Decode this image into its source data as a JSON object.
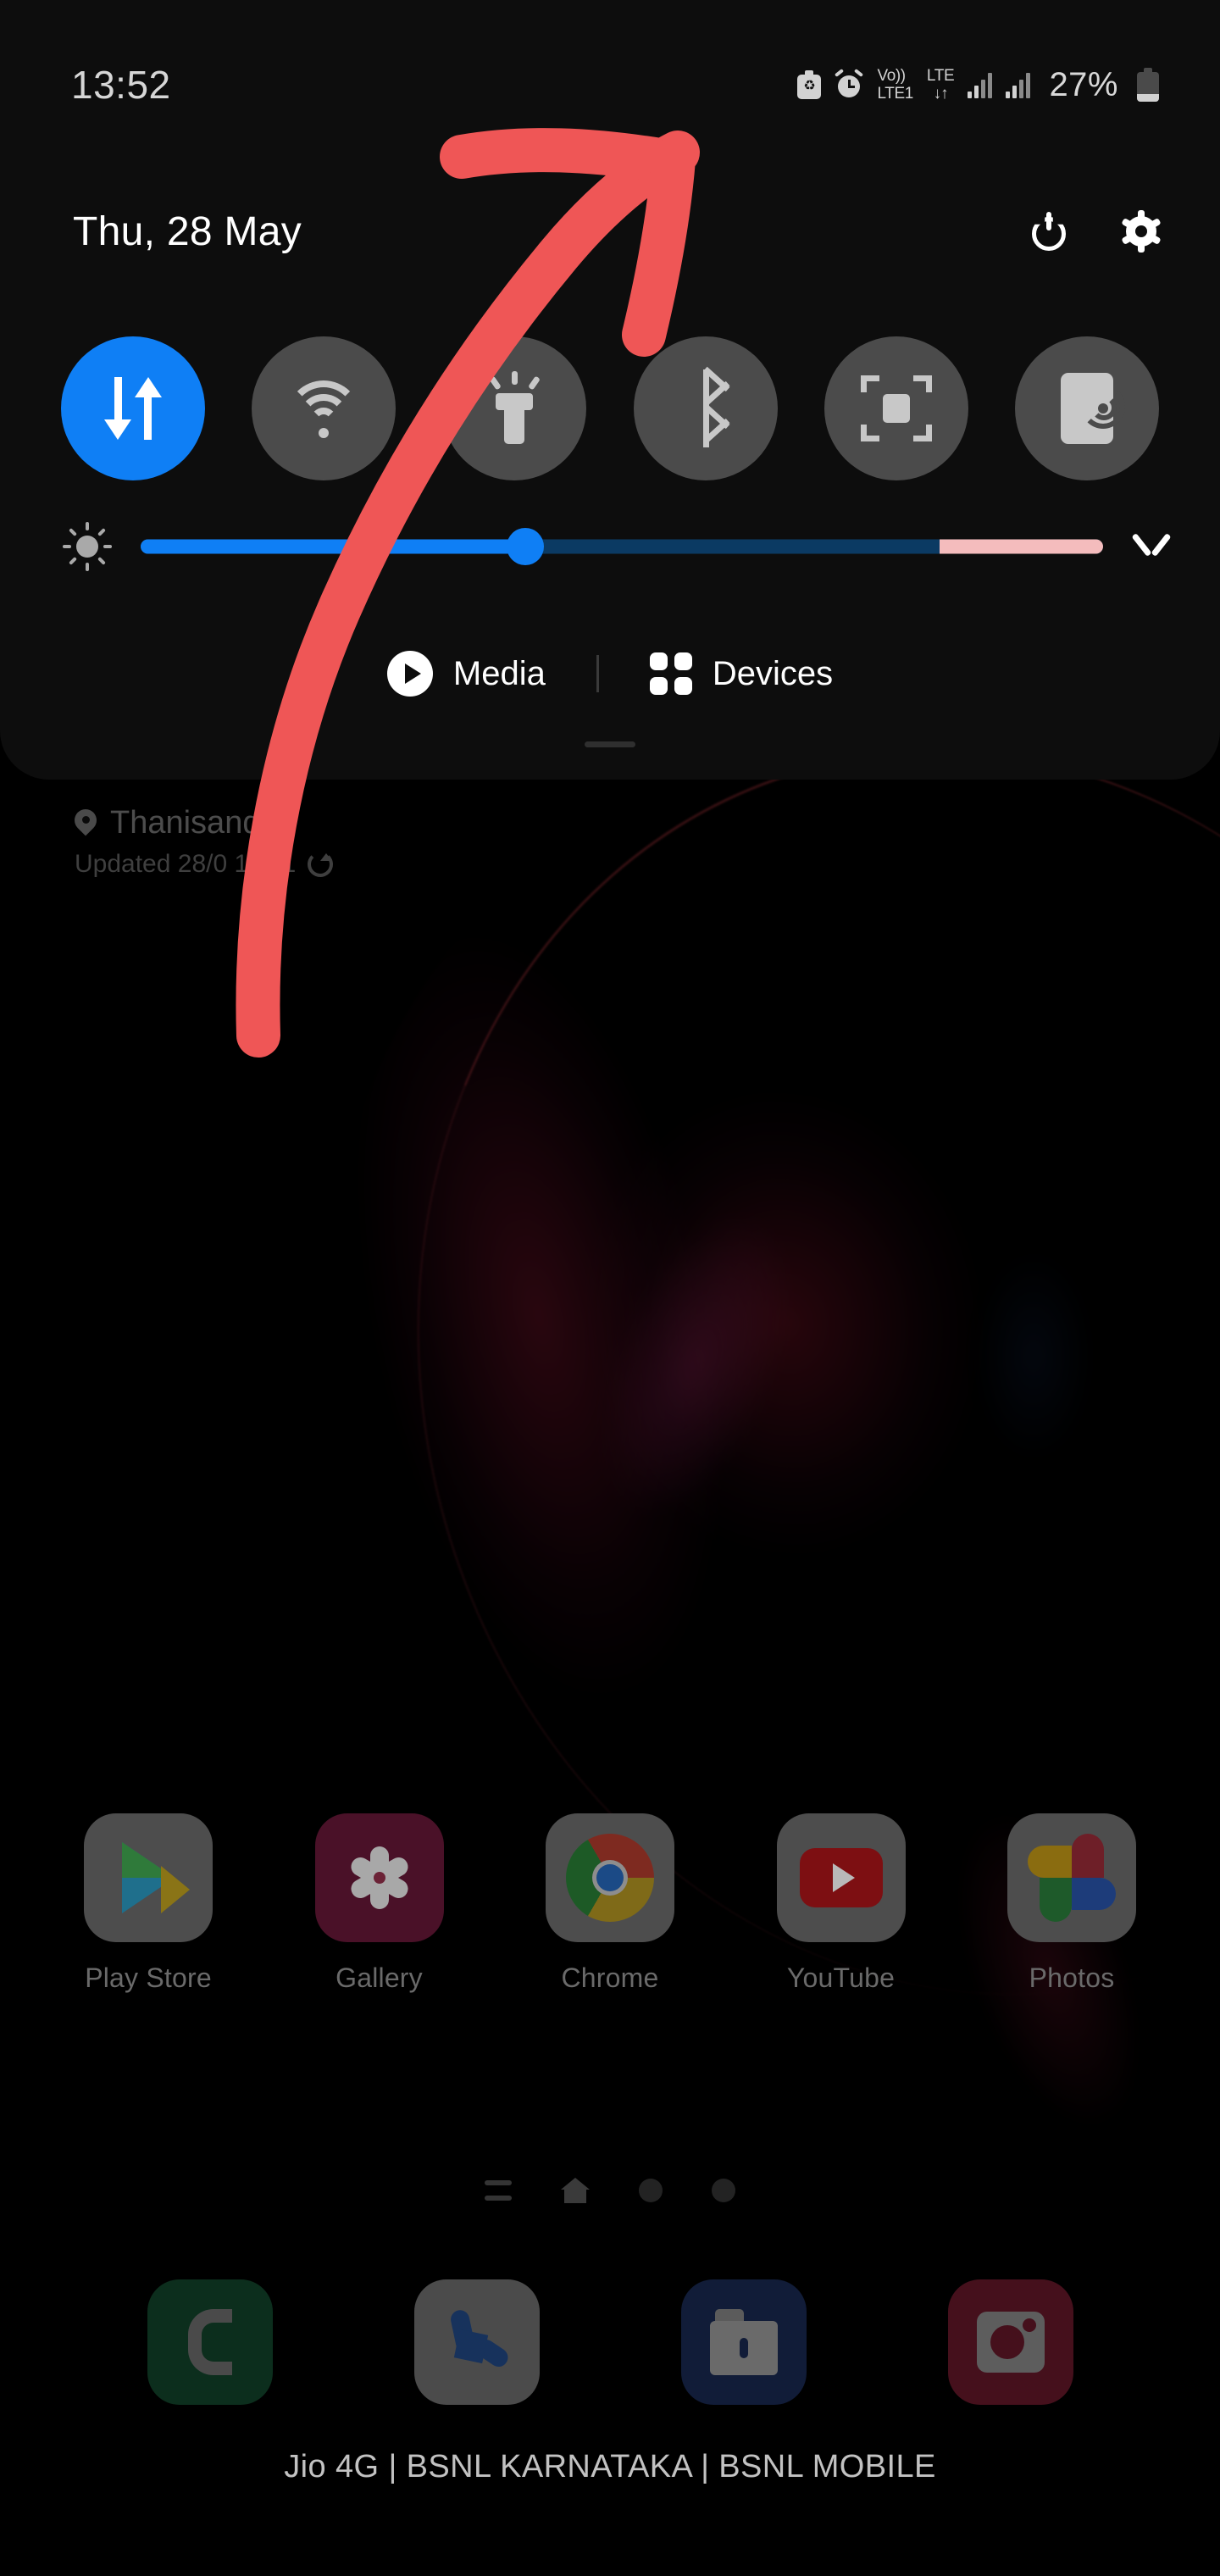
{
  "status_bar": {
    "time": "13:52",
    "battery_percent": "27%",
    "icons": [
      {
        "name": "battery-saver-icon",
        "glyph": "♻"
      },
      {
        "name": "alarm-icon",
        "glyph": ""
      },
      {
        "name": "volte-icon",
        "line1": "Vo))",
        "line2": "LTE1"
      },
      {
        "name": "lte-data-icon",
        "line1": "LTE",
        "arrows": "↓↑"
      },
      {
        "name": "signal-sim1-icon",
        "glyph": ""
      },
      {
        "name": "signal-sim2-icon",
        "glyph": ""
      },
      {
        "name": "battery-icon",
        "glyph": ""
      }
    ]
  },
  "quick_panel": {
    "date": "Thu, 28 May",
    "power_label": "Power",
    "settings_label": "Settings",
    "toggles": [
      {
        "id": "mobile-data",
        "label": "Mobile data",
        "active": true
      },
      {
        "id": "wifi",
        "label": "Wi-Fi",
        "active": false
      },
      {
        "id": "flashlight",
        "label": "Flashlight",
        "active": false
      },
      {
        "id": "bluetooth",
        "label": "Bluetooth",
        "active": false
      },
      {
        "id": "smart-view",
        "label": "Smart View",
        "active": false
      },
      {
        "id": "nfc",
        "label": "NFC",
        "active": false
      }
    ],
    "brightness": {
      "icon": "brightness-icon",
      "value_percent": 40,
      "expand_label": "Expand brightness options"
    },
    "media_button": {
      "label": "Media",
      "icon": "play-icon"
    },
    "devices_button": {
      "label": "Devices",
      "icon": "devices-grid-icon"
    },
    "handle_label": "Drag handle"
  },
  "weather_widget": {
    "city": "Thanisandra",
    "updated": "Updated 28/0  11:21",
    "refresh_label": "Refresh"
  },
  "home_screen": {
    "apps": [
      {
        "name": "play-store",
        "label": "Play Store"
      },
      {
        "name": "gallery",
        "label": "Gallery"
      },
      {
        "name": "chrome",
        "label": "Chrome"
      },
      {
        "name": "youtube",
        "label": "YouTube"
      },
      {
        "name": "photos",
        "label": "Photos"
      }
    ],
    "page_indicator": {
      "items": [
        "apps-list-icon",
        "home-icon",
        "page-dot",
        "page-dot"
      ]
    },
    "dock": [
      {
        "name": "contacts",
        "label": "Contacts"
      },
      {
        "name": "phone",
        "label": "Phone"
      },
      {
        "name": "secure-folder",
        "label": "Secure Folder"
      },
      {
        "name": "camera",
        "label": "Camera"
      }
    ],
    "carrier_text": "Jio 4G | BSNL KARNATAKA | BSNL MOBILE"
  },
  "annotation": {
    "type": "hand-drawn-arrow",
    "color": "#ef5656",
    "points_to": "status-bar-icons"
  },
  "colors": {
    "accent_blue": "#0f7ff5",
    "toggle_off": "#4b4b4b",
    "panel_bg": "#0d0d0d",
    "annotation_red": "#ef5656"
  }
}
